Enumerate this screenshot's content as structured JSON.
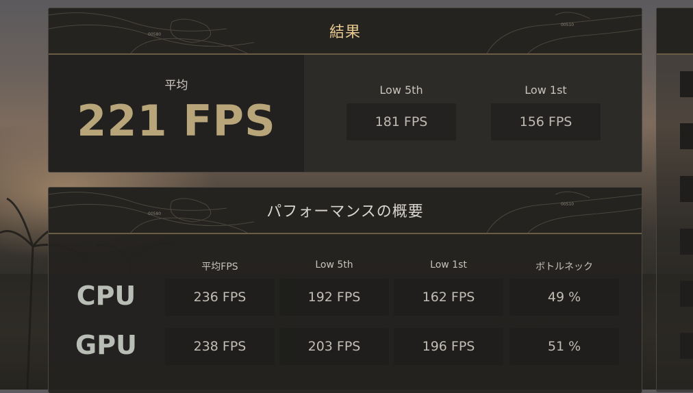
{
  "results": {
    "title": "結果",
    "average_label": "平均",
    "average_value": "221 FPS",
    "low5_label": "Low 5th",
    "low5_value": "181 FPS",
    "low1_label": "Low 1st",
    "low1_value": "156 FPS"
  },
  "overview": {
    "title": "パフォーマンスの概要",
    "columns": [
      "平均FPS",
      "Low 5th",
      "Low 1st",
      "ボトルネック"
    ],
    "rows": [
      {
        "label": "CPU",
        "values": [
          "236 FPS",
          "192 FPS",
          "162 FPS",
          "49 %"
        ]
      },
      {
        "label": "GPU",
        "values": [
          "238 FPS",
          "203 FPS",
          "196 FPS",
          "51 %"
        ]
      }
    ]
  },
  "map_marks": [
    "00580",
    "00510"
  ],
  "colors": {
    "accent_gold": "#b9a57a",
    "title_gold": "#e7c98f",
    "divider": "#6b5c44"
  }
}
